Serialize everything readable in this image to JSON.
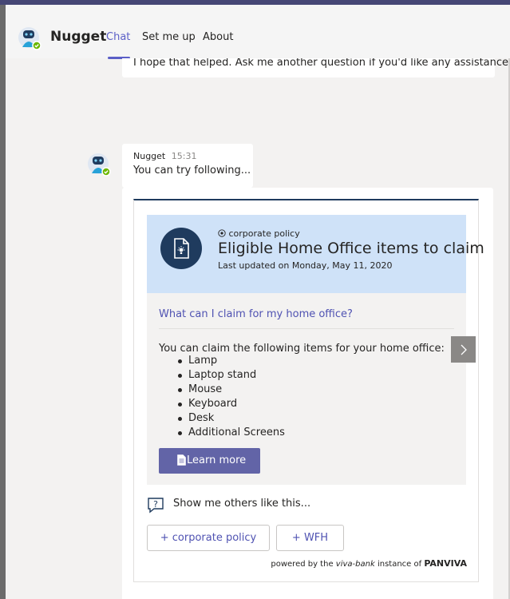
{
  "header": {
    "bot_name": "Nugget",
    "tabs": [
      {
        "label": "Chat",
        "active": true
      },
      {
        "label": "Set me up",
        "active": false
      },
      {
        "label": "About",
        "active": false
      }
    ]
  },
  "messages": {
    "previous_text": "I hope that helped. Ask me another question if you'd like any assistance.",
    "sender": "Nugget",
    "time": "15:31",
    "text": "You can try following..."
  },
  "card": {
    "tag": "corporate policy",
    "title": "Eligible Home Office items to claim",
    "updated": "Last updated on Monday, May 11, 2020",
    "question": "What can I claim for my home office?",
    "intro": "You can claim the following items for your home office:",
    "items": [
      "Lamp",
      "Laptop stand",
      "Mouse",
      "Keyboard",
      "Desk",
      "Additional Screens"
    ],
    "learn_more": "Learn more",
    "others_label": "Show me others like this...",
    "chips": [
      "+ corporate policy",
      "+ WFH"
    ],
    "powered": {
      "prefix": "powered by the",
      "instance": "viva-bank",
      "middle": "instance of",
      "brand": "PANVIVA"
    }
  },
  "icons": {
    "avatar": "robot-avatar-icon",
    "status": "available-check-icon",
    "card": "document-lightbulb-icon",
    "tag": "target-icon",
    "learn": "document-icon",
    "others": "question-bubble-icon",
    "carousel": "chevron-right-icon"
  },
  "colors": {
    "accent": "#5b5fc7",
    "button": "#6264a7",
    "card_header": "#cfe2f8",
    "navy": "#1f3b5e",
    "status": "#6bb700"
  }
}
